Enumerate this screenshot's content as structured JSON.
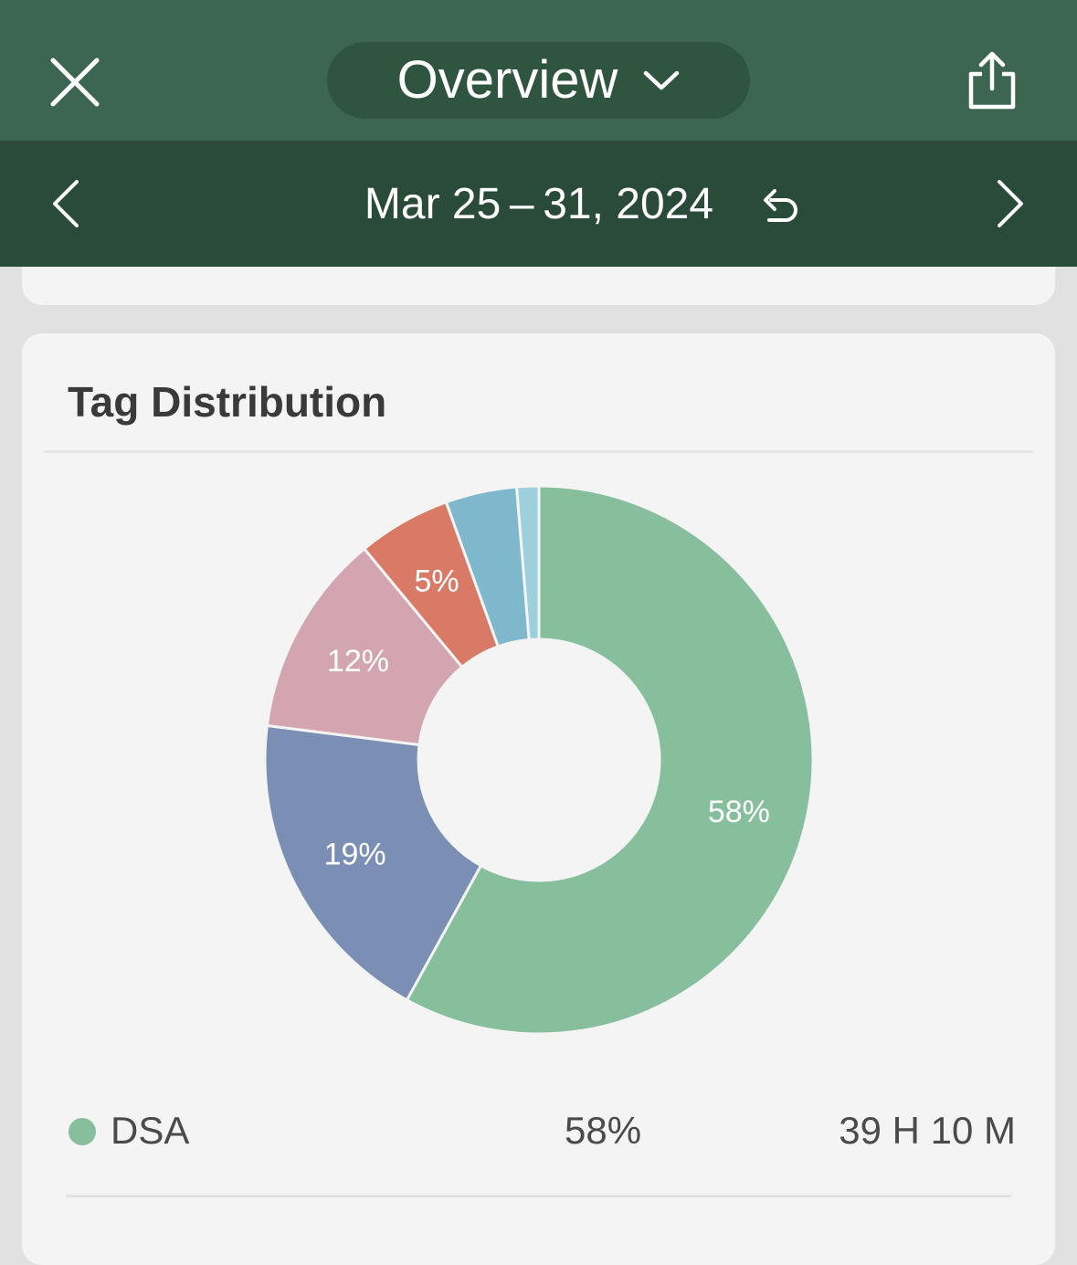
{
  "header": {
    "view_label": "Overview"
  },
  "date_nav": {
    "range_label": "Mar 25 – 31, 2024"
  },
  "card": {
    "title": "Tag Distribution"
  },
  "chart_data": {
    "type": "pie",
    "donut": true,
    "slices": [
      {
        "value": 58,
        "label": "58%",
        "color": "#87bf9d"
      },
      {
        "value": 19,
        "label": "19%",
        "color": "#7b8fb5"
      },
      {
        "value": 12,
        "label": "12%",
        "color": "#d2a5b0"
      },
      {
        "value": 5.5,
        "label": "5%",
        "color": "#d87a65"
      },
      {
        "value": 4.2,
        "label": "",
        "color": "#7fb8cc"
      },
      {
        "value": 1.3,
        "label": "",
        "color": "#9dd0dc"
      }
    ]
  },
  "legend": [
    {
      "name": "DSA",
      "percent": "58%",
      "duration": "39 H 10 M",
      "color": "#87bf9d"
    }
  ],
  "colors": {
    "header_bg": "#3c6652",
    "date_bar_bg": "#2a4a3a",
    "pill_bg": "#2f5541",
    "card_bg": "#f4f4f4",
    "page_bg": "#e1e1e1"
  }
}
